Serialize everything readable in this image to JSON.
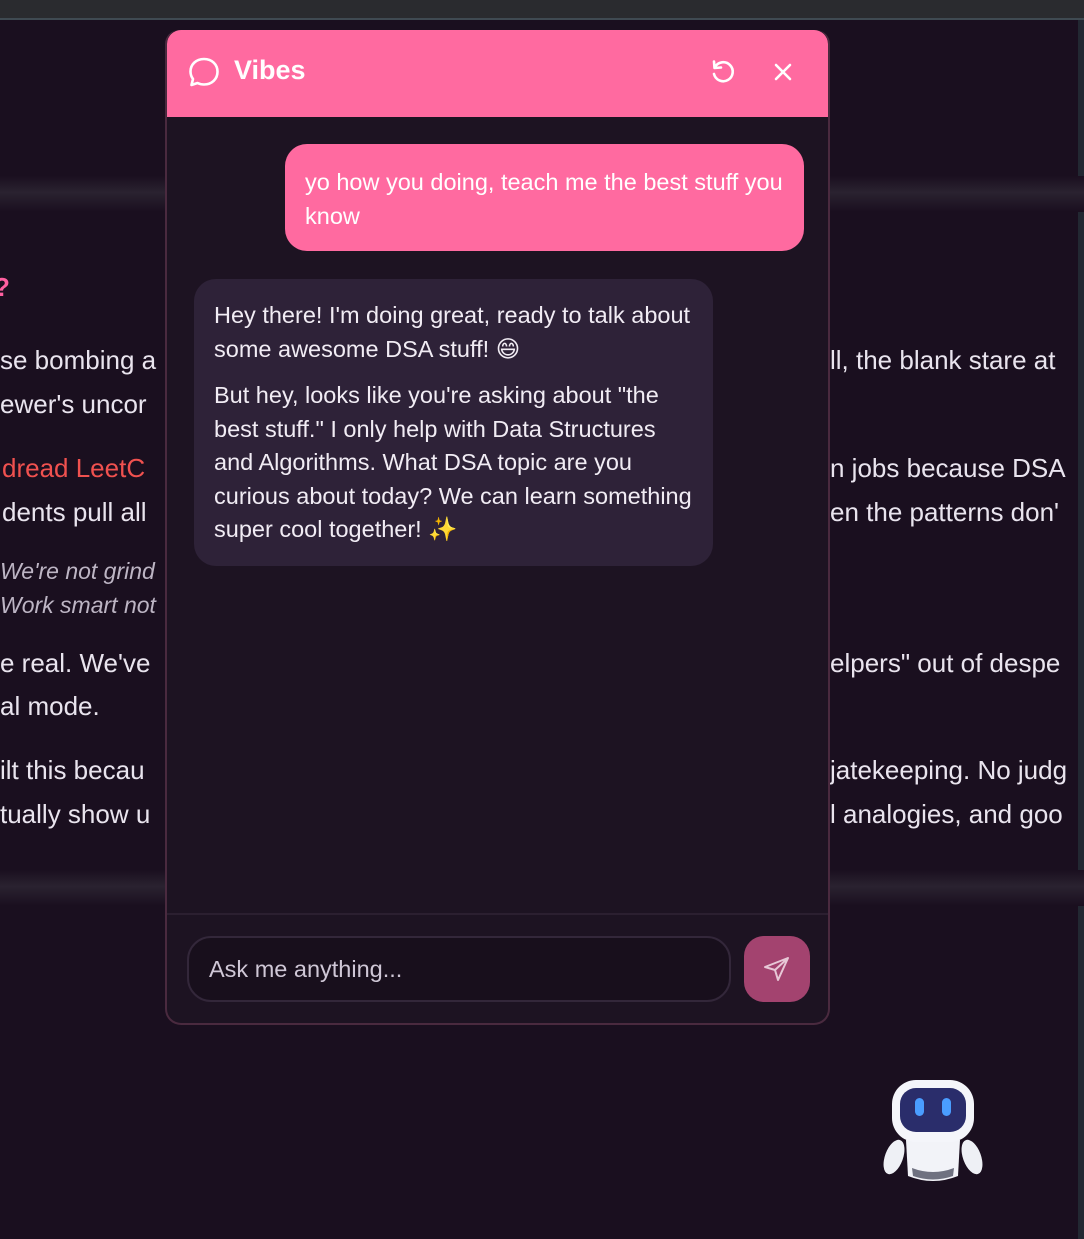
{
  "background": {
    "left_fragments": [
      "?",
      "se bombing a",
      "ewer's uncor",
      "dread LeetC",
      "dents pull all",
      "We're not grind",
      "Work smart not",
      "e real. We've",
      "al mode.",
      "ilt this becau",
      "tually show u"
    ],
    "right_fragments": [
      "ll, the blank stare at",
      "n jobs because DSA",
      "en the patterns don'",
      "elpers\" out of despe",
      "jatekeeping. No judg",
      "l analogies, and goo"
    ]
  },
  "chat": {
    "title": "Vibes",
    "header_icons": [
      "chat-bubble-icon",
      "refresh-icon",
      "close-icon"
    ],
    "messages": {
      "user": "yo how you doing, teach me the best stuff you know",
      "bot_p1": "Hey there! I'm doing great, ready to talk about some awesome DSA stuff! 😄",
      "bot_p2": "But hey, looks like you're asking about \"the best stuff.\" I only help with Data Structures and Algorithms. What DSA topic are you curious about today? We can learn something super cool together! ✨"
    },
    "input": {
      "placeholder": "Ask me anything...",
      "value": ""
    },
    "send_icon": "send-icon"
  },
  "launcher_icon": "robot-icon",
  "colors": {
    "accent": "#ff6aa0",
    "panel": "#1d1322",
    "bot_bubble": "#2e2238",
    "send_button": "#a3436f",
    "background": "#1a0f1f"
  }
}
